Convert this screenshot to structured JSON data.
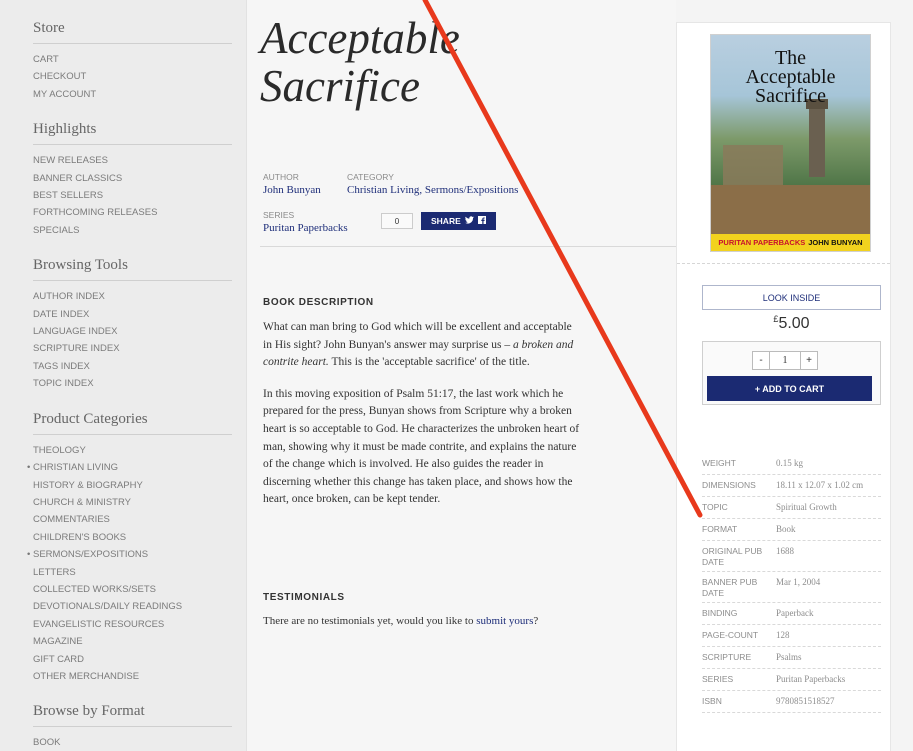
{
  "sidebar": {
    "store": {
      "heading": "Store",
      "items": [
        "CART",
        "CHECKOUT",
        "MY ACCOUNT"
      ]
    },
    "highlights": {
      "heading": "Highlights",
      "items": [
        "NEW RELEASES",
        "BANNER CLASSICS",
        "BEST SELLERS",
        "FORTHCOMING RELEASES",
        "SPECIALS"
      ]
    },
    "browsing": {
      "heading": "Browsing Tools",
      "items": [
        "AUTHOR INDEX",
        "DATE INDEX",
        "LANGUAGE INDEX",
        "SCRIPTURE INDEX",
        "TAGS INDEX",
        "TOPIC INDEX"
      ]
    },
    "categories": {
      "heading": "Product Categories",
      "items": [
        "THEOLOGY",
        "CHRISTIAN LIVING",
        "HISTORY & BIOGRAPHY",
        "CHURCH & MINISTRY",
        "COMMENTARIES",
        "CHILDREN'S BOOKS",
        "SERMONS/EXPOSITIONS",
        "LETTERS",
        "COLLECTED WORKS/SETS",
        "DEVOTIONALS/DAILY READINGS",
        "EVANGELISTIC RESOURCES",
        "MAGAZINE",
        "GIFT CARD",
        "OTHER MERCHANDISE"
      ]
    },
    "format": {
      "heading": "Browse by Format",
      "items": [
        "BOOK"
      ]
    }
  },
  "product": {
    "title_line1": "Acceptable",
    "title_line2": "Sacrifice",
    "author_label": "AUTHOR",
    "author": "John Bunyan",
    "category_label": "CATEGORY",
    "category": "Christian Living, Sermons/Expositions",
    "series_label": "SERIES",
    "series": "Puritan Paperbacks",
    "share_count": "0",
    "share_label": "SHARE"
  },
  "description": {
    "heading": "BOOK DESCRIPTION",
    "p1_a": "What can man bring to God which will be excellent and acceptable in His sight? John Bunyan's answer may surprise us – ",
    "p1_em": "a broken and contrite heart.",
    "p1_b": " This is the 'acceptable sacrifice' of the title.",
    "p2": "In this moving exposition of Psalm 51:17, the last work which he prepared for the press, Bunyan shows from Scripture why a broken heart is so acceptable to God. He characterizes the unbroken heart of man, showing why it must be made contrite, and explains the nature of the change which is involved. He also guides the reader in discerning whether this change has taken place, and shows how the heart, once broken, can be kept tender."
  },
  "testimonials": {
    "heading": "TESTIMONIALS",
    "text": "There are no testimonials yet, would you like to ",
    "link": "submit yours",
    "suffix": "?"
  },
  "cover": {
    "title_line1": "The",
    "title_line2": "Acceptable",
    "title_line3": "Sacrifice",
    "band_series": "PURITAN PAPERBACKS",
    "band_author": "JOHN BUNYAN"
  },
  "purchase": {
    "look_inside": "LOOK INSIDE",
    "currency": "£",
    "price": "5.00",
    "qty_minus": "-",
    "qty_value": "1",
    "qty_plus": "+",
    "add_to_cart": "+ ADD TO CART"
  },
  "specs": [
    {
      "key": "WEIGHT",
      "value": "0.15 kg"
    },
    {
      "key": "DIMENSIONS",
      "value": "18.11 x 12.07 x 1.02 cm"
    },
    {
      "key": "TOPIC",
      "value": "Spiritual Growth"
    },
    {
      "key": "FORMAT",
      "value": "Book"
    },
    {
      "key": "ORIGINAL PUB DATE",
      "value": "1688"
    },
    {
      "key": "BANNER PUB DATE",
      "value": "Mar 1, 2004"
    },
    {
      "key": "BINDING",
      "value": "Paperback"
    },
    {
      "key": "PAGE-COUNT",
      "value": "128"
    },
    {
      "key": "SCRIPTURE",
      "value": "Psalms"
    },
    {
      "key": "SERIES",
      "value": "Puritan Paperbacks"
    },
    {
      "key": "ISBN",
      "value": "9780851518527"
    }
  ],
  "colors": {
    "accent": "#1b2a72",
    "annotation": "#e8391c",
    "cover_band": "#f2d21e"
  }
}
